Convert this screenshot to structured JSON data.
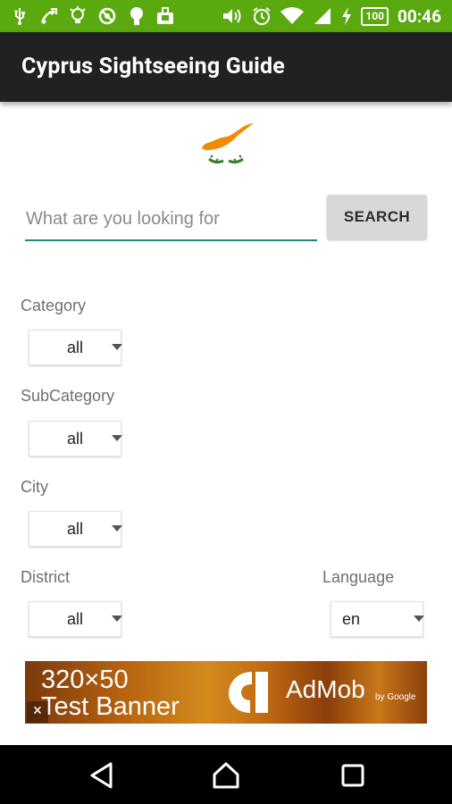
{
  "status_bar": {
    "time": "00:46",
    "battery": "100",
    "background": "#5aa90e"
  },
  "toolbar": {
    "title": "Cyprus Sightseeing Guide",
    "background": "#212121"
  },
  "search": {
    "placeholder": "What are you looking for",
    "value": "",
    "button_label": "SEARCH",
    "accent_color": "#1b8a7d"
  },
  "filters": {
    "category": {
      "label": "Category",
      "selected": "all"
    },
    "subcategory": {
      "label": "SubCategory",
      "selected": "all"
    },
    "city": {
      "label": "City",
      "selected": "all"
    },
    "district": {
      "label": "District",
      "selected": "all"
    },
    "language": {
      "label": "Language",
      "selected": "en"
    }
  },
  "ad": {
    "line1": "320×50",
    "line2": "Test Banner",
    "brand": "AdMob",
    "by": "by Google",
    "close": "×"
  },
  "icons": {
    "status_left": [
      "usb-icon",
      "missed-call-icon",
      "bulb-icon",
      "blocked-icon",
      "android-icon",
      "bag-icon"
    ],
    "status_right": [
      "volume-icon",
      "alarm-icon",
      "wifi-icon",
      "signal-icon",
      "charging-icon",
      "battery-icon"
    ],
    "nav": [
      "back-icon",
      "home-icon",
      "recents-icon"
    ]
  }
}
